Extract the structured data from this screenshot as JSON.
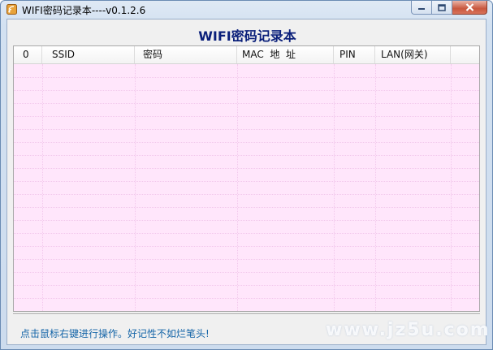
{
  "window": {
    "title": "WIFI密码记录本----v0.1.2.6"
  },
  "main": {
    "heading": "WIFI密码记录本",
    "columns": [
      "0",
      "SSID",
      "密码",
      "MAC  地  址",
      "PIN",
      "LAN(网关)"
    ]
  },
  "status": {
    "hint": "点击鼠标右键进行操作。好记性不如烂笔头!"
  },
  "watermark": "www.jz5u.com",
  "colors": {
    "list_background": "#ffe6fb",
    "heading": "#0a1f7a",
    "status_text": "#1565a8"
  },
  "icons": {
    "app": "wifi-book-icon",
    "minimize": "minimize-icon",
    "maximize": "maximize-icon",
    "close": "close-icon"
  }
}
